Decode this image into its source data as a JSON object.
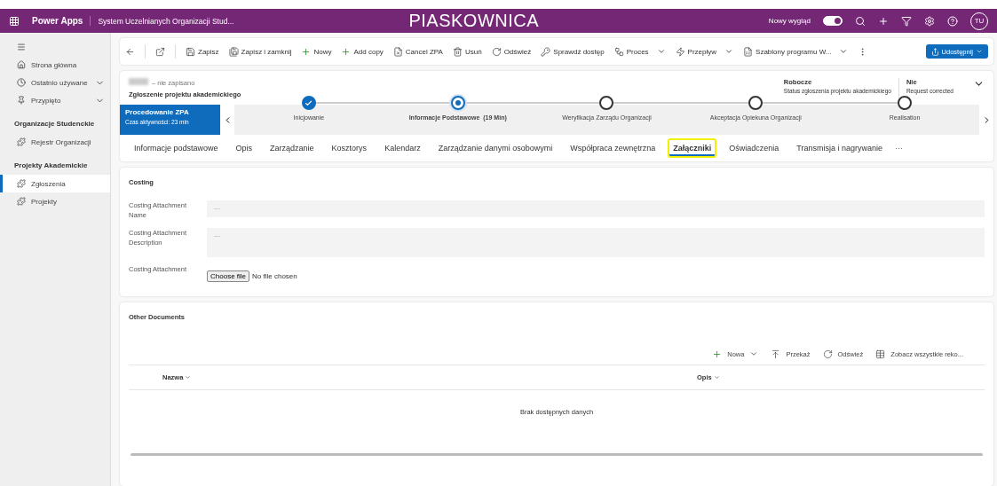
{
  "header": {
    "app_name": "Power Apps",
    "app_title": "System Uczelnianych Organizacji Stud...",
    "environment": "PIASKOWNICA",
    "new_look_label": "Nowy wygląd",
    "new_look_on": true,
    "avatar": "TU"
  },
  "sidebar": {
    "top_items": [
      {
        "kind": "home",
        "label": "Strona główna"
      },
      {
        "kind": "recent",
        "label": "Ostatnio używane",
        "expanded": false
      },
      {
        "kind": "pinned",
        "label": "Przypięto",
        "expanded": false
      }
    ],
    "groups": [
      {
        "title": "Organizacje Studenckie",
        "items": [
          {
            "label": "Rejestr Organizacji",
            "selected": false
          }
        ]
      },
      {
        "title": "Projekty Akademickie",
        "items": [
          {
            "label": "Zgłoszenia",
            "selected": true
          },
          {
            "label": "Projekty",
            "selected": false
          }
        ]
      }
    ]
  },
  "command_bar": {
    "items": [
      {
        "kind": "save",
        "label": "Zapisz",
        "dropdown": false
      },
      {
        "kind": "save_close",
        "label": "Zapisz i zamknij",
        "dropdown": false
      },
      {
        "kind": "new",
        "label": "Nowy",
        "dropdown": false
      },
      {
        "kind": "new",
        "label": "Add copy",
        "dropdown": false
      },
      {
        "kind": "cancel",
        "label": "Cancel ZPA",
        "dropdown": false
      },
      {
        "kind": "delete",
        "label": "Usuń",
        "dropdown": false
      },
      {
        "kind": "refresh",
        "label": "Odśwież",
        "dropdown": false
      },
      {
        "kind": "access",
        "label": "Sprawdź dostęp",
        "dropdown": false
      },
      {
        "kind": "process",
        "label": "Proces",
        "dropdown": true
      },
      {
        "kind": "flow",
        "label": "Przepływ",
        "dropdown": true
      },
      {
        "kind": "template",
        "label": "Szablony programu W...",
        "dropdown": true
      }
    ],
    "share_label": "Udostępnij"
  },
  "record": {
    "save_state": "– nie zapisano",
    "entity": "Zgłoszenie projektu akademickiego",
    "fields": [
      {
        "value": "Robocze",
        "label": "Status zgłoszenia projektu akademickiego"
      },
      {
        "value": "Nie",
        "label": "Request corrected"
      }
    ]
  },
  "process": {
    "name": "Procedowanie ZPA",
    "active_time": "Czas aktywności: 23 min",
    "stages": [
      {
        "label": "Inicjowanie",
        "completed": true,
        "selected": false
      },
      {
        "label": "Informacje Podstawowe  (19 Min)",
        "completed": false,
        "selected": true
      },
      {
        "label": "Weryfikacja Zarządu Organizacji",
        "completed": false,
        "selected": false
      },
      {
        "label": "Akceptacja Opiekuna Organizacji",
        "completed": false,
        "selected": false
      },
      {
        "label": "Realisation",
        "completed": false,
        "selected": false
      }
    ]
  },
  "tabs": [
    {
      "label": "Informacje podstawowe",
      "selected": false,
      "highlighted": false
    },
    {
      "label": "Opis",
      "selected": false,
      "highlighted": false
    },
    {
      "label": "Zarządzanie",
      "selected": false,
      "highlighted": false
    },
    {
      "label": "Kosztorys",
      "selected": false,
      "highlighted": false
    },
    {
      "label": "Kalendarz",
      "selected": false,
      "highlighted": false
    },
    {
      "label": "Zarządzanie danymi osobowymi",
      "selected": false,
      "highlighted": false
    },
    {
      "label": "Współpraca zewnętrzna",
      "selected": false,
      "highlighted": false
    },
    {
      "label": "Załączniki",
      "selected": true,
      "highlighted": true
    },
    {
      "label": "Oświadczenia",
      "selected": false,
      "highlighted": false
    },
    {
      "label": "Transmisja i nagrywanie",
      "selected": false,
      "highlighted": false
    }
  ],
  "tabs_more": "···",
  "costing": {
    "title": "Costing",
    "fields": [
      {
        "kind": "text",
        "label": "Costing Attachment Name",
        "placeholder": "---"
      },
      {
        "kind": "textarea",
        "label": "Costing Attachment Description",
        "placeholder": "---"
      },
      {
        "kind": "file",
        "label": "Costing Attachment",
        "button": "Choose file",
        "value": "No file chosen"
      }
    ]
  },
  "other_documents": {
    "title": "Other Documents",
    "actions": [
      {
        "kind": "new",
        "label": "Nowa",
        "dropdown": true
      },
      {
        "kind": "upload",
        "label": "Przekaż",
        "dropdown": false
      },
      {
        "kind": "refresh",
        "label": "Odśwież",
        "dropdown": false
      },
      {
        "kind": "view",
        "label": "Zobacz wszystkie reko...",
        "dropdown": false
      }
    ],
    "columns": [
      "Nazwa",
      "Opis"
    ],
    "empty_text": "Brak dostępnych danych"
  }
}
